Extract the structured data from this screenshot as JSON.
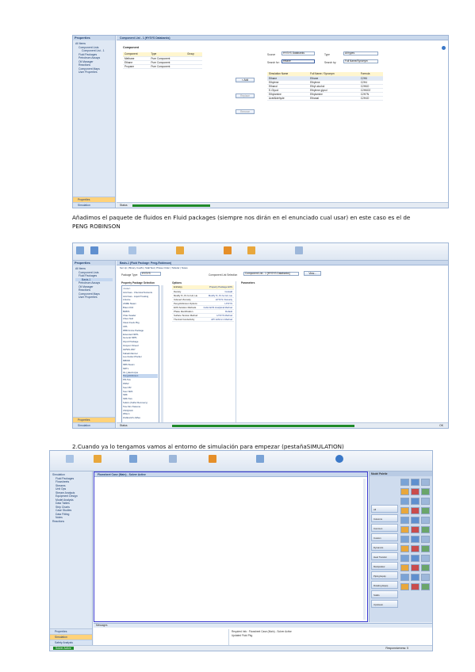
{
  "caption1": {
    "line1": "Añadimos el paquete de fluidos en Fluid packages (siempre nos dirán en el enunciado cual usar) en este caso es el de",
    "line2": "PENG ROBINSON"
  },
  "caption2": "2.Cuando ya lo tengamos vamos al entorno de simulación para empezar (pestañaSIMULATION)",
  "shot1": {
    "nav_head": "Properties",
    "tree": [
      "All Items",
      "Component Lists",
      "Component List - 1",
      "Fluid Packages",
      "Petroleum Assays",
      "Oil Manager",
      "Reactions",
      "Component Maps",
      "User Properties"
    ],
    "nav_bottom": [
      "Properties",
      "Simulation"
    ],
    "tab": "Component List - 1 (HYSYS Databanks)",
    "list_title": "Component",
    "headers": [
      "Component",
      "Type",
      "Group"
    ],
    "rows": [
      [
        "Methane",
        "Pure Component",
        ""
      ],
      [
        "Ethane",
        "Pure Component",
        ""
      ],
      [
        "Propane",
        "Pure Component",
        ""
      ]
    ],
    "source_label": "Source",
    "source_value": "HYSYS Databanks",
    "search_label": "Search for:",
    "search_value": "ethane",
    "type_label": "Type",
    "type_value": "All types",
    "search_by_label": "Search by:",
    "search_by_value": "Full Name/Synonym",
    "buttons": [
      "< Add",
      "Replace",
      "Remove"
    ],
    "table2_headers": [
      "Simulation Name",
      "Full Name / Synonym",
      "Formula"
    ],
    "table2_rows": [
      [
        "Ethane",
        "Ethane",
        "C2H6"
      ],
      [
        "Ethylene",
        "Ethylene",
        "C2H4"
      ],
      [
        "Ethanol",
        "Ethyl alcohol",
        "C2H6O"
      ],
      [
        "E-Glycol",
        "Ethylene glycol",
        "C2H6O2"
      ],
      [
        "Ethylamine",
        "Ethylamine",
        "C2H7N"
      ],
      [
        "AcetAldehyde",
        "Ethanal",
        "C2H4O"
      ]
    ],
    "status_label": "Status"
  },
  "shot2": {
    "nav_head": "Properties",
    "tree": [
      "All Items",
      "Component Lists",
      "Fluid Packages",
      "Basis-1",
      "Petroleum Assays",
      "Oil Manager",
      "Reactions",
      "Component Maps",
      "User Properties"
    ],
    "nav_bottom": [
      "Properties",
      "Simulation"
    ],
    "tab": "Basis-1 (Fluid Package: Peng-Robinson)",
    "subtabs": "Set Up | Binary Coeffs | StabTest | Phase Order | Tabular | Notes",
    "pkg_type_label": "Package Type:",
    "pkg_type_value": "HYSYS",
    "comp_list_label": "Component List Selection",
    "comp_list_value": "Component List - 1 [HYSYS Databanks]",
    "view_button": "View...",
    "list_head": "Property Package Selection",
    "packages": [
      "<none>",
      "Acid Gas - Chemical Solvents",
      "Acid Gas - Liquid Treating",
      "Antoine",
      "ASME Steam",
      "Braun K10",
      "BWRS",
      "Chao Seader",
      "Chien Null",
      "Clean Fuels Pkg",
      "CPA",
      "DBR Amine Package",
      "Extended NRTL",
      "General NRTL",
      "Glycol Package",
      "Grayson Streed",
      "IAPWS-IF97",
      "Kabadi-Danner",
      "Lee-Kesler-Plocker",
      "MBWR",
      "NBS Steam",
      "NRTL",
      "OLI_Electrolyte",
      "Peng-Robinson",
      "PR-Twu",
      "PRSV",
      "Sour PR",
      "Sour SRK",
      "SRK",
      "SRK-Twu",
      "Sulsim (Sulfur Recovery)",
      "Twu-Sim-Tassone",
      "UNIQUAC",
      "Wilson",
      "Zudkevitch-Joffee"
    ],
    "options_head": "Options",
    "options": [
      [
        "Enthalpy",
        "Property Package EOS"
      ],
      [
        "Density",
        "Costald"
      ],
      [
        "Modify Tc, Pc for H2, He",
        "Modify Tc, Pc for H2, He"
      ],
      [
        "Indexed Viscosity",
        "HYSYS Viscosity"
      ],
      [
        "Peng-Robinson Options",
        "HYSYS"
      ],
      [
        "EOS Solution Methods",
        "Cubic EOS Analytical Method"
      ],
      [
        "Phase Identification",
        "Default"
      ],
      [
        "Surface Tension Method",
        "HYSYS Method"
      ],
      [
        "Thermal Conductivity",
        "API 12A3.2-1 Method"
      ]
    ],
    "params_head": "Parameters",
    "status_label": "Status",
    "status_right": "OK"
  },
  "shot3": {
    "tree": [
      "Simulation",
      "Fluid Packages",
      "Flowsheets",
      "Streams",
      "Unit Ops",
      "Stream Analysis",
      "Equipment Design",
      "Model Analysis",
      "Data Tables",
      "Strip Charts",
      "Case Studies",
      "Data Fitting",
      "Notes",
      "Reactions"
    ],
    "nav_bottom": [
      "Properties",
      "Simulation",
      "Safety Analysis",
      "Energy Analysis"
    ],
    "tab": "Flowsheet Case (Main) - Solver Active",
    "palette_head": "Model Palette",
    "palette_groups": [
      "All",
      "Columns",
      "Common",
      "Custom",
      "Dynamics",
      "Heat Transfer",
      "Manipulator",
      "Piping Equip",
      "Rotating Equip",
      "Solids",
      "Upstream"
    ],
    "messages_head": "Messages",
    "message_lines": [
      "Required Info : Flowsheet Case (Main) - Solver Active",
      "Updated Fluid Pkg"
    ],
    "status_left": "Solver Active",
    "status_right": "Responsiveness: 5"
  },
  "colors": {
    "progress": "#1f8a2a",
    "nav_active": "#ffd27a",
    "frame": "#9fb6d6",
    "palette_bg": "#cfdcee"
  }
}
